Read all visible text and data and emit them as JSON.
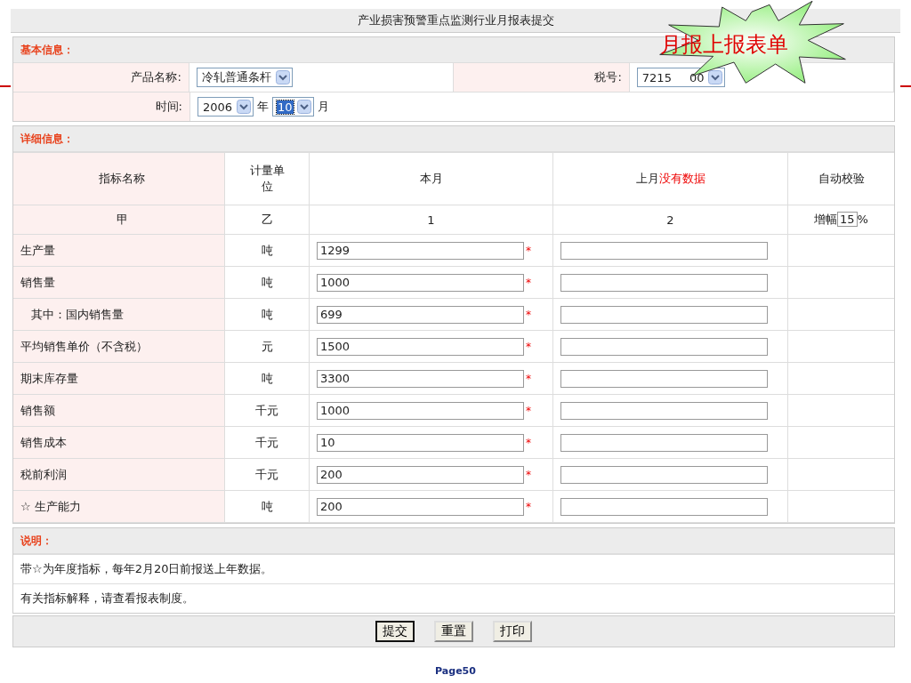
{
  "form": {
    "title": "产业损害预警重点监测行业月报表提交",
    "basic_info": {
      "heading": "基本信息：",
      "product_label": "产品名称:",
      "product_value": "冷轧普通条杆",
      "tax_label": "税号:",
      "tax_value": "7215",
      "tax_value_tail": "00",
      "time_label": "时间:",
      "year_value": "2006",
      "year_unit": "年",
      "month_value": "10",
      "month_highlighted": true,
      "month_unit": "月"
    },
    "detail_info": {
      "heading": "详细信息：",
      "columns": [
        {
          "label": "指标名称"
        },
        {
          "label": "计量单位"
        },
        {
          "label": "本月"
        },
        {
          "label": "上月",
          "note": "没有数据"
        },
        {
          "label": "自动校验"
        }
      ],
      "index_row": [
        "甲",
        "乙",
        "1",
        "2"
      ],
      "check": {
        "label": "增幅",
        "value": "15",
        "unit": "%"
      },
      "rows": [
        {
          "name": "生产量",
          "unit": "吨",
          "current": "1299",
          "required_mark": "*"
        },
        {
          "name": "销售量",
          "unit": "吨",
          "current": "1000",
          "required_mark": "*",
          "children": [
            {
              "name": "其中：国内销售量",
              "unit": "吨",
              "current": "699",
              "required_mark": "*"
            }
          ]
        },
        {
          "name": "平均销售单价（不含税）",
          "unit": "元",
          "current": "1500",
          "required_mark": "*"
        },
        {
          "name": "期末库存量",
          "unit": "吨",
          "current": "3300",
          "required_mark": "*"
        },
        {
          "name": "销售额",
          "unit": "千元",
          "current": "1000",
          "required_mark": "*"
        },
        {
          "name": "销售成本",
          "unit": "千元",
          "current": "10",
          "required_mark": "*"
        },
        {
          "name": "税前利润",
          "unit": "千元",
          "current": "200",
          "required_mark": "*"
        },
        {
          "name": "☆ 生产能力",
          "unit": "吨",
          "current": "200",
          "required_mark": "*"
        }
      ]
    },
    "notes": {
      "heading": "说明：",
      "lines": [
        "带☆为年度指标，每年2月20日前报送上年数据。",
        "有关指标解释，请查看报表制度。"
      ]
    },
    "buttons": [
      {
        "label": "提交",
        "default": true
      },
      {
        "label": "重置",
        "default": false
      },
      {
        "label": "打印",
        "default": false
      }
    ]
  },
  "callout": {
    "text": "月报上报表单"
  },
  "slide": {
    "page": "Page50"
  }
}
